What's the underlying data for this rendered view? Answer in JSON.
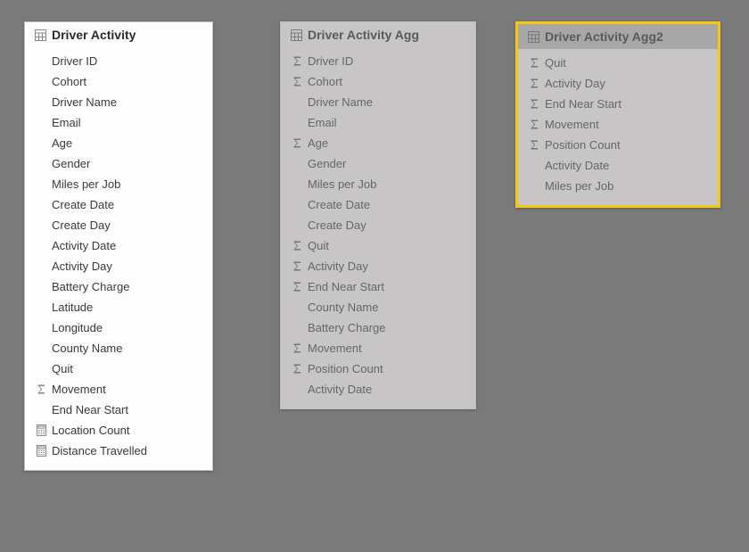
{
  "tables": [
    {
      "title": "Driver Activity",
      "style": "normal",
      "fields": [
        {
          "label": "Driver ID",
          "icon": "none"
        },
        {
          "label": "Cohort",
          "icon": "none"
        },
        {
          "label": "Driver Name",
          "icon": "none"
        },
        {
          "label": "Email",
          "icon": "none"
        },
        {
          "label": "Age",
          "icon": "none"
        },
        {
          "label": "Gender",
          "icon": "none"
        },
        {
          "label": "Miles per Job",
          "icon": "none"
        },
        {
          "label": "Create Date",
          "icon": "none"
        },
        {
          "label": "Create Day",
          "icon": "none"
        },
        {
          "label": "Activity Date",
          "icon": "none"
        },
        {
          "label": "Activity Day",
          "icon": "none"
        },
        {
          "label": "Battery Charge",
          "icon": "none"
        },
        {
          "label": "Latitude",
          "icon": "none"
        },
        {
          "label": "Longitude",
          "icon": "none"
        },
        {
          "label": "County Name",
          "icon": "none"
        },
        {
          "label": "Quit",
          "icon": "none"
        },
        {
          "label": "Movement",
          "icon": "sigma"
        },
        {
          "label": "End Near Start",
          "icon": "none"
        },
        {
          "label": "Location Count",
          "icon": "calc"
        },
        {
          "label": "Distance Travelled",
          "icon": "calc"
        }
      ]
    },
    {
      "title": "Driver Activity Agg",
      "style": "dimmed",
      "fields": [
        {
          "label": "Driver ID",
          "icon": "sigma"
        },
        {
          "label": "Cohort",
          "icon": "sigma"
        },
        {
          "label": "Driver Name",
          "icon": "none"
        },
        {
          "label": "Email",
          "icon": "none"
        },
        {
          "label": "Age",
          "icon": "sigma"
        },
        {
          "label": "Gender",
          "icon": "none"
        },
        {
          "label": "Miles per Job",
          "icon": "none"
        },
        {
          "label": "Create Date",
          "icon": "none"
        },
        {
          "label": "Create Day",
          "icon": "none"
        },
        {
          "label": "Quit",
          "icon": "sigma"
        },
        {
          "label": "Activity Day",
          "icon": "sigma"
        },
        {
          "label": "End Near Start",
          "icon": "sigma"
        },
        {
          "label": "County Name",
          "icon": "none"
        },
        {
          "label": "Battery Charge",
          "icon": "none"
        },
        {
          "label": "Movement",
          "icon": "sigma"
        },
        {
          "label": "Position Count",
          "icon": "sigma"
        },
        {
          "label": "Activity Date",
          "icon": "none"
        }
      ]
    },
    {
      "title": "Driver Activity Agg2",
      "style": "selected-dimmed",
      "fields": [
        {
          "label": "Quit",
          "icon": "sigma"
        },
        {
          "label": "Activity Day",
          "icon": "sigma"
        },
        {
          "label": "End Near Start",
          "icon": "sigma"
        },
        {
          "label": "Movement",
          "icon": "sigma"
        },
        {
          "label": "Position Count",
          "icon": "sigma"
        },
        {
          "label": "Activity Date",
          "icon": "none"
        },
        {
          "label": "Miles per Job",
          "icon": "none"
        }
      ]
    }
  ]
}
